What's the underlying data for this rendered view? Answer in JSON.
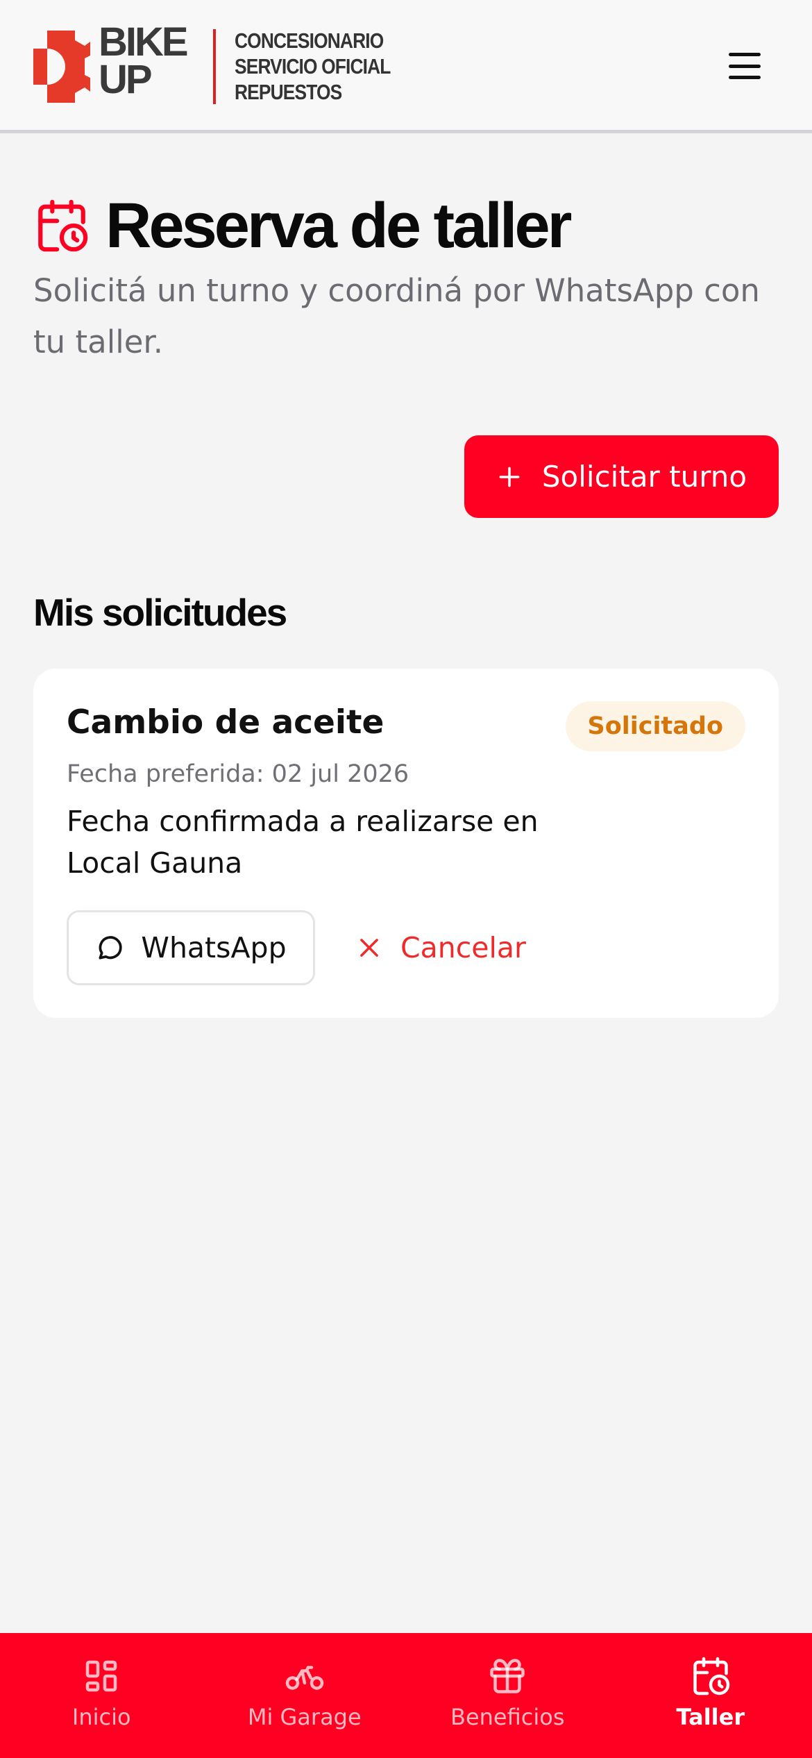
{
  "brand": {
    "name_line1": "BIKE",
    "name_line2": "UP",
    "tagline": [
      "CONCESIONARIO",
      "SERVICIO OFICIAL",
      "REPUESTOS"
    ],
    "accent_color": "#ff0022"
  },
  "header": {
    "menu_icon": "hamburger-menu-icon"
  },
  "page": {
    "title": "Reserva de taller",
    "title_icon": "calendar-clock-icon",
    "subtitle": "Solicitá un turno y coordiná por WhatsApp con tu taller.",
    "primary_action": {
      "label": "Solicitar turno",
      "icon": "plus-icon"
    }
  },
  "requests": {
    "section_title": "Mis solicitudes",
    "items": [
      {
        "title": "Cambio de aceite",
        "status": "Solicitado",
        "status_color": "#d4760a",
        "preferred_date": "Fecha preferida: 02 jul 2026",
        "description": "Fecha confirmada a realizarse en Local Gauna",
        "whatsapp_label": "WhatsApp",
        "cancel_label": "Cancelar"
      }
    ]
  },
  "nav": {
    "items": [
      {
        "label": "Inicio",
        "icon": "dashboard-grid-icon",
        "active": false
      },
      {
        "label": "Mi Garage",
        "icon": "motorcycle-icon",
        "active": false
      },
      {
        "label": "Beneficios",
        "icon": "gift-icon",
        "active": false
      },
      {
        "label": "Taller",
        "icon": "calendar-clock-icon",
        "active": true
      }
    ]
  }
}
